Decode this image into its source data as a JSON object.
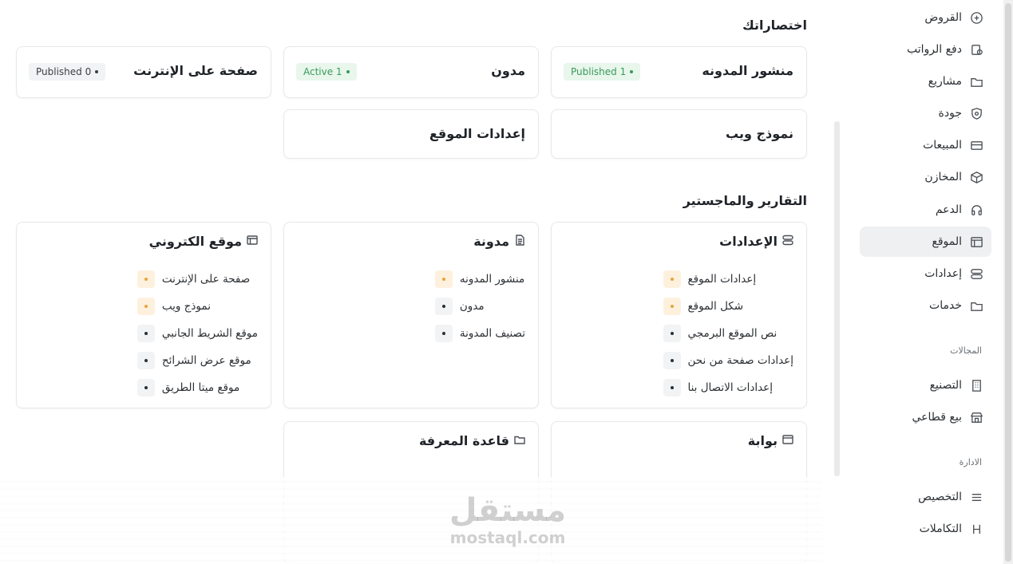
{
  "sidebar": {
    "items": [
      {
        "label": "القروض",
        "icon": "loan-icon"
      },
      {
        "label": "دفع الرواتب",
        "icon": "payroll-icon"
      },
      {
        "label": "مشاريع",
        "icon": "folder-icon"
      },
      {
        "label": "جودة",
        "icon": "quality-shield-icon"
      },
      {
        "label": "المبيعات",
        "icon": "sales-card-icon"
      },
      {
        "label": "المخازن",
        "icon": "box-icon"
      },
      {
        "label": "الدعم",
        "icon": "headset-icon"
      },
      {
        "label": "الموقع",
        "icon": "website-window-icon",
        "active": true
      },
      {
        "label": "إعدادات",
        "icon": "settings-toggle-icon"
      },
      {
        "label": "خدمات",
        "icon": "services-folder-icon"
      }
    ],
    "domains_section": "المجالات",
    "domains": [
      {
        "label": "التصنيع",
        "icon": "factory-icon"
      },
      {
        "label": "بيع قطاعي",
        "icon": "store-icon"
      }
    ],
    "admin_section": "الادارة",
    "admin": [
      {
        "label": "التخصيص",
        "icon": "customize-icon"
      },
      {
        "label": "التكاملات",
        "icon": "integrations-icon"
      }
    ]
  },
  "shortcuts": {
    "heading": "اختصاراتك",
    "cards": [
      {
        "title": "منشور المدونه",
        "badge": "Published 1",
        "badge_color": "green"
      },
      {
        "title": "مدون",
        "badge": "Active 1",
        "badge_color": "green"
      },
      {
        "title": "صفحة على الإنترنت",
        "badge": "Published 0",
        "badge_color": "gray"
      },
      {
        "title": "نموذج ويب"
      },
      {
        "title": "إعدادات الموقع"
      }
    ]
  },
  "reports": {
    "heading": "التقارير والماجستير",
    "cards": [
      {
        "title": "الإعدادات",
        "icon": "settings-toggle-icon",
        "links": [
          {
            "label": "إعدادات الموقع",
            "bullet": "orange"
          },
          {
            "label": "شكل الموقع",
            "bullet": "orange"
          },
          {
            "label": "نص الموقع البرمجي",
            "bullet": "gray"
          },
          {
            "label": "إعدادات صفحة من نحن",
            "bullet": "gray"
          },
          {
            "label": "إعدادات الاتصال بنا",
            "bullet": "gray"
          }
        ]
      },
      {
        "title": "مدونة",
        "icon": "document-icon",
        "links": [
          {
            "label": "منشور المدونه",
            "bullet": "orange"
          },
          {
            "label": "مدون",
            "bullet": "gray"
          },
          {
            "label": "تصنيف المدونة",
            "bullet": "gray"
          }
        ]
      },
      {
        "title": "موقع الكتروني",
        "icon": "website-window-icon",
        "links": [
          {
            "label": "صفحة على الإنترنت",
            "bullet": "orange"
          },
          {
            "label": "نموذج ويب",
            "bullet": "orange"
          },
          {
            "label": "موقع الشريط الجانبي",
            "bullet": "gray"
          },
          {
            "label": "موقع عرض الشرائح",
            "bullet": "gray"
          },
          {
            "label": "موقع ميتا الطريق",
            "bullet": "gray"
          }
        ]
      },
      {
        "title": "بوابة",
        "icon": "website-window-icon"
      },
      {
        "title": "قاعدة المعرفة",
        "icon": "folder-icon"
      }
    ]
  },
  "watermark": {
    "line1": "مستقل",
    "line2": "mostaql.com"
  },
  "colors": {
    "accent_green": "#3a9a5b",
    "accent_orange": "#e8a33a",
    "active_bg": "#eef0f2"
  }
}
